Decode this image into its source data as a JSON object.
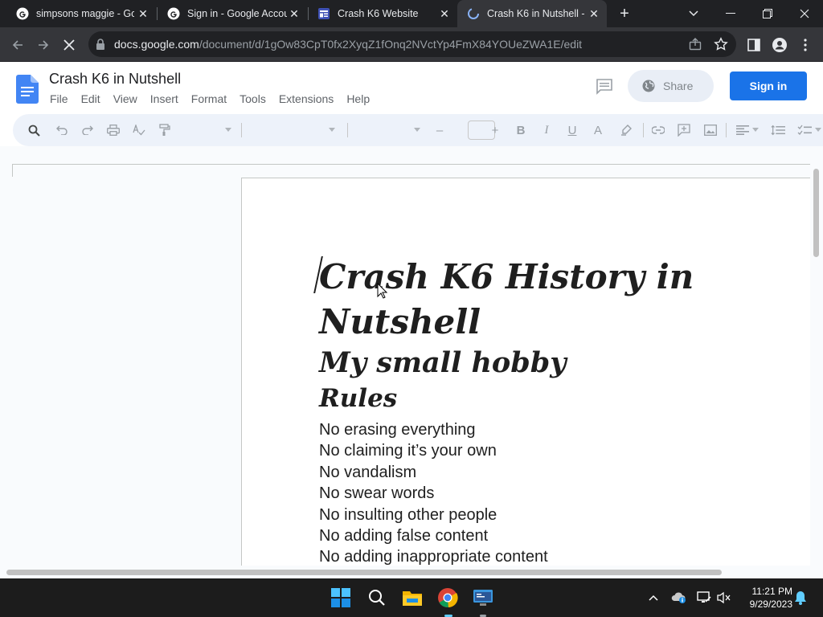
{
  "browser": {
    "tabs": [
      {
        "title": "simpsons maggie - Goo",
        "favicon": "google-g-icon",
        "active": false
      },
      {
        "title": "Sign in - Google Accou",
        "favicon": "google-g-icon",
        "active": false
      },
      {
        "title": "Crash K6 Website",
        "favicon": "google-sites-icon",
        "active": false
      },
      {
        "title": "Crash K6 in Nutshell - (",
        "favicon": "docs-loading-icon",
        "active": true
      }
    ],
    "url_host": "docs.google.com",
    "url_path": "/document/d/1gOw83CpT0fx2XyqZ1fOnq2NVctYp4FmX84YOUeZWA1E/edit"
  },
  "docs": {
    "title": "Crash K6 in Nutshell",
    "menu": [
      "File",
      "Edit",
      "View",
      "Insert",
      "Format",
      "Tools",
      "Extensions",
      "Help"
    ],
    "share_label": "Share",
    "signin_label": "Sign in"
  },
  "document": {
    "heading": "Crash K6 History in Nutshell",
    "subheading": "My small hobby",
    "rules_heading": "Rules",
    "rules": [
      "No erasing everything",
      "No claiming it’s your own",
      "No vandalism",
      "No swear words",
      "No insulting other people",
      "No adding false content",
      "No adding inappropriate content"
    ]
  },
  "taskbar": {
    "time": "11:21 PM",
    "date": "9/29/2023"
  },
  "colors": {
    "accent": "#1a73e8",
    "chrome_dark": "#202124",
    "chrome_toolbar": "#35363a",
    "docs_toolbar": "#edf2fa"
  }
}
